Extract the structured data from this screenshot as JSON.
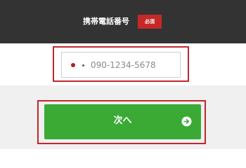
{
  "header": {
    "title": "携帯電話番号",
    "required_badge": "必須"
  },
  "phone_field": {
    "country_flag_icon": "japan-flag-icon",
    "placeholder": "090-1234-5678"
  },
  "next_button": {
    "label": "次へ",
    "icon": "arrow-right-circle-icon"
  },
  "colors": {
    "header_bg": "#333333",
    "badge_red": "#c62828",
    "highlight_red": "#c1272d",
    "button_green": "#3aaa35"
  }
}
